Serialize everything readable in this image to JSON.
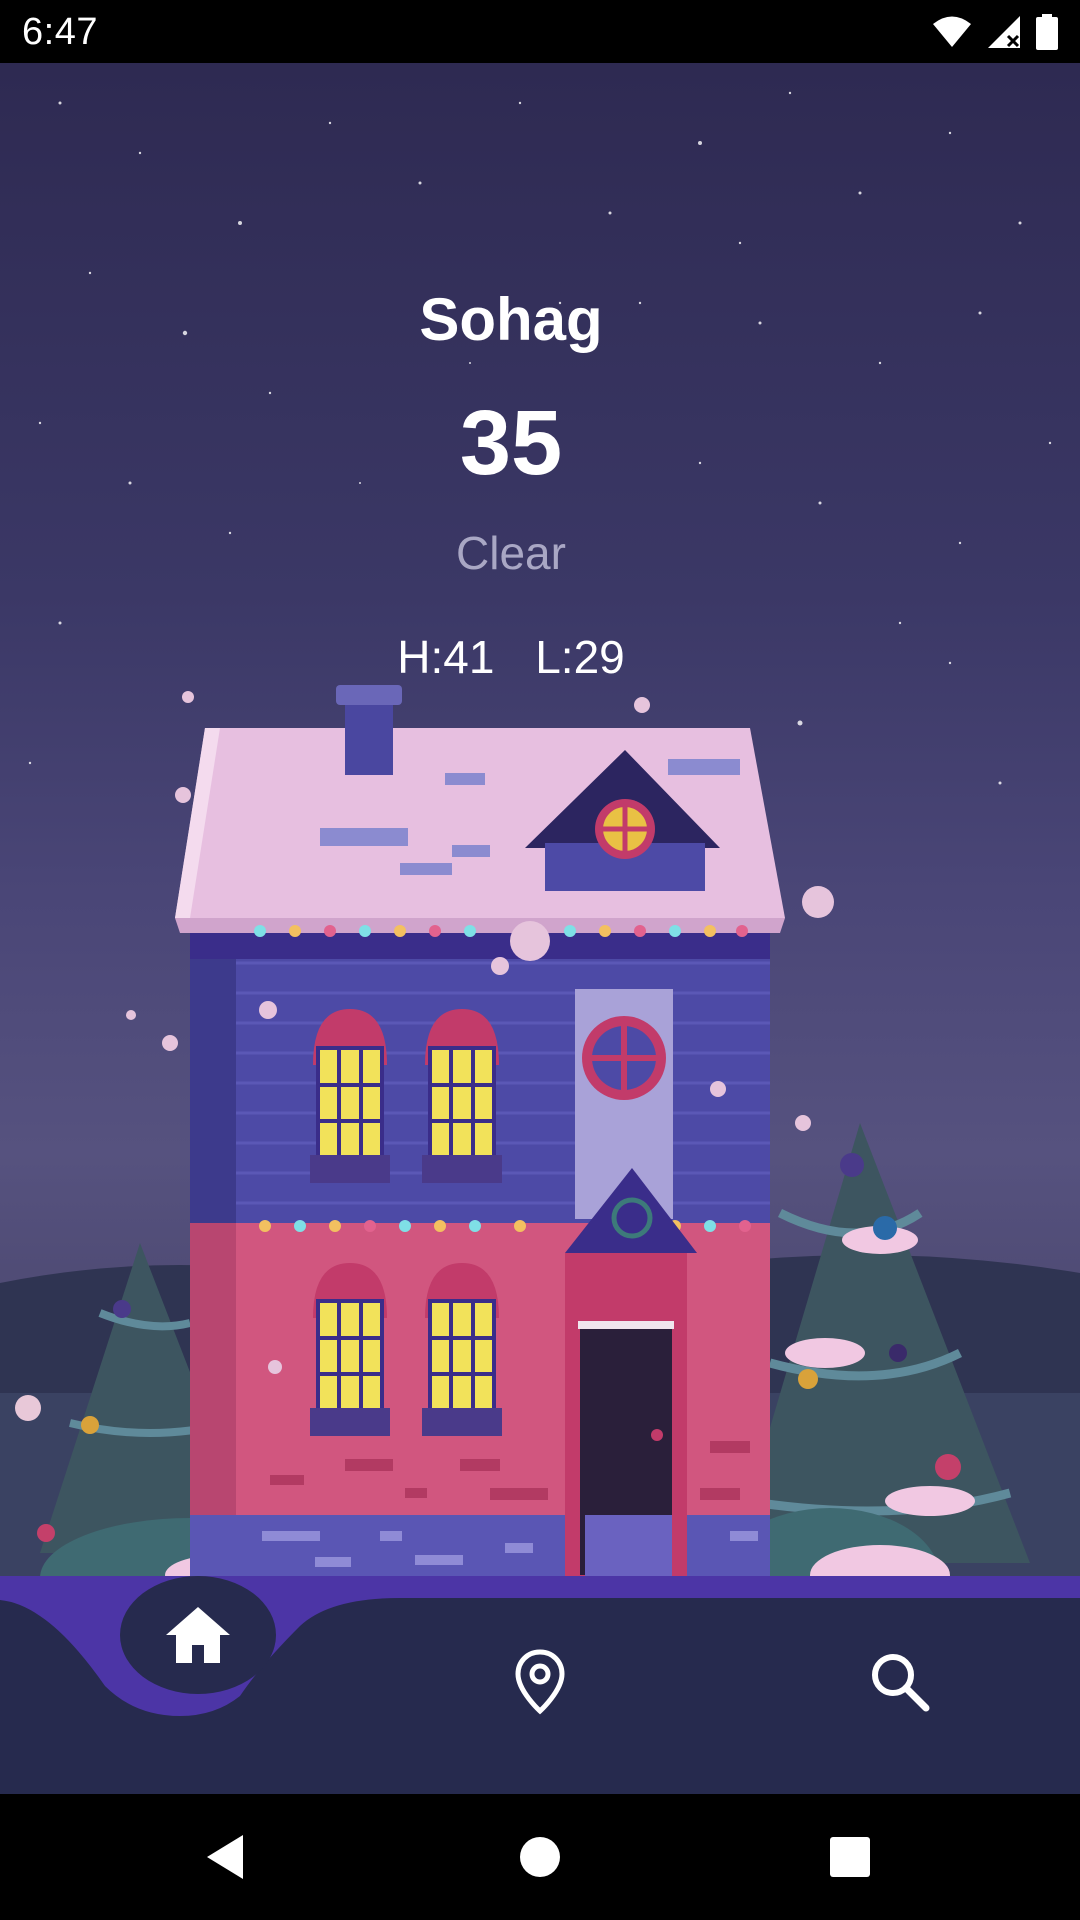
{
  "status_bar": {
    "time": "6:47",
    "icons": [
      "wifi-icon",
      "cell-signal-icon",
      "battery-icon"
    ]
  },
  "weather": {
    "city": "Sohag",
    "temperature": "35",
    "condition": "Clear",
    "high": "H:41",
    "low": "L:29"
  },
  "background": {
    "scene": "night-house-illustration",
    "sky_color": "#3b3866"
  },
  "bottom_nav": {
    "background_color": "#262a4e",
    "accent_color": "#4c35a6",
    "selected": "home",
    "items": [
      {
        "id": "home",
        "icon": "home-icon"
      },
      {
        "id": "location",
        "icon": "location-pin-icon"
      },
      {
        "id": "search",
        "icon": "search-icon"
      }
    ]
  },
  "system_nav": {
    "items": [
      "back-icon",
      "home-circle-icon",
      "recents-icon"
    ]
  }
}
